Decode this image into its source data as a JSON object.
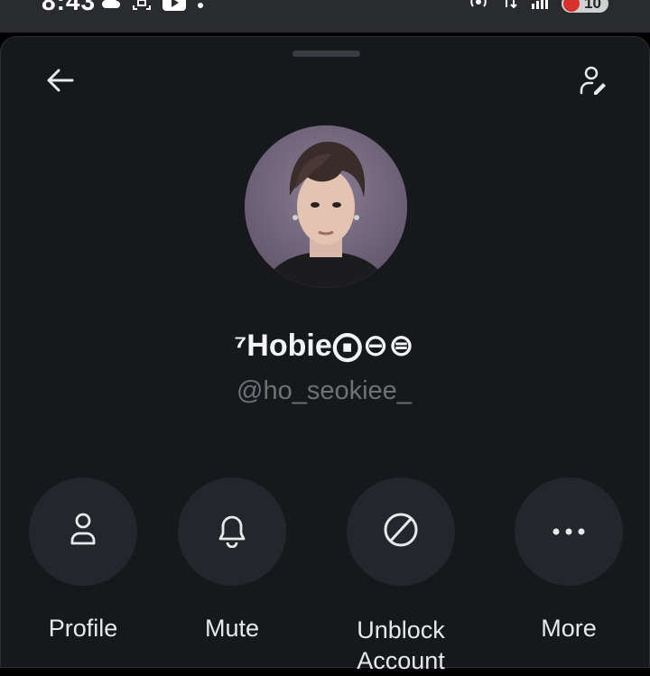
{
  "status_bar": {
    "time": "8:43",
    "battery_level": "10",
    "left_icons": [
      "cloud-icon",
      "face-scan-icon",
      "youtube-icon",
      "dot-icon"
    ],
    "right_icons": [
      "hotspot-icon",
      "data-arrows-icon",
      "signal-icon",
      "battery-icon"
    ]
  },
  "header": {
    "back_icon": "arrow-left-icon",
    "edit_icon": "user-edit-icon"
  },
  "profile": {
    "display_name": "⁷Hobie⨀⊖⊜",
    "handle": "@ho_seokiee_"
  },
  "actions": [
    {
      "label": "Profile",
      "icon": "person-icon"
    },
    {
      "label": "Mute",
      "icon": "bell-icon"
    },
    {
      "label": "Unblock Account",
      "icon": "block-icon"
    },
    {
      "label": "More",
      "icon": "more-dots-icon"
    }
  ],
  "colors": {
    "background": "#17181c",
    "action_circle": "#24262b",
    "text_primary": "#e7e9ea",
    "text_secondary": "#6e7277"
  }
}
